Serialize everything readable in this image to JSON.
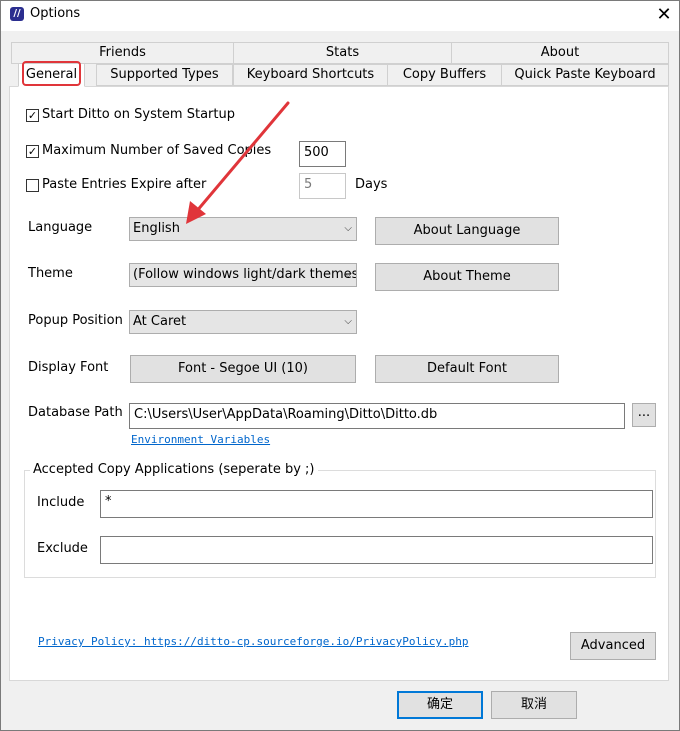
{
  "window": {
    "title": "Options",
    "close_symbol": "✕",
    "icon_glyph": "//"
  },
  "tabs": {
    "row1": [
      "Friends",
      "Stats",
      "About"
    ],
    "row2": [
      "General",
      "Supported Types",
      "Keyboard Shortcuts",
      "Copy Buffers",
      "Quick Paste Keyboard"
    ],
    "active": "General"
  },
  "general": {
    "start_on_startup": {
      "label": "Start Ditto on System Startup",
      "checked": true
    },
    "max_copies": {
      "label": "Maximum Number of Saved Copies",
      "checked": true,
      "value": "500"
    },
    "expire": {
      "label": "Paste Entries Expire after",
      "checked": false,
      "value": "5",
      "unit": "Days"
    },
    "language": {
      "label": "Language",
      "value": "English",
      "button": "About Language"
    },
    "theme": {
      "label": "Theme",
      "value": "(Follow windows light/dark themes)",
      "button": "About Theme"
    },
    "popup": {
      "label": "Popup Position",
      "value": "At Caret"
    },
    "font": {
      "label": "Display Font",
      "button": "Font - Segoe UI (10)",
      "default_button": "Default Font"
    },
    "db": {
      "label": "Database Path",
      "value": "C:\\Users\\User\\AppData\\Roaming\\Ditto\\Ditto.db",
      "browse": "...",
      "env_link": "Environment Variables"
    },
    "accepted": {
      "title": "Accepted Copy Applications (seperate by ;)",
      "include_label": "Include",
      "include_value": "*",
      "exclude_label": "Exclude",
      "exclude_value": ""
    },
    "privacy_link": "Privacy Policy: https://ditto-cp.sourceforge.io/PrivacyPolicy.php",
    "advanced": "Advanced"
  },
  "footer": {
    "ok": "确定",
    "cancel": "取消"
  },
  "colors": {
    "accent": "#0078d7",
    "highlight": "#e0353a",
    "link": "#0066cc"
  },
  "check_glyph": "✓",
  "chevron_glyph": "⌵"
}
